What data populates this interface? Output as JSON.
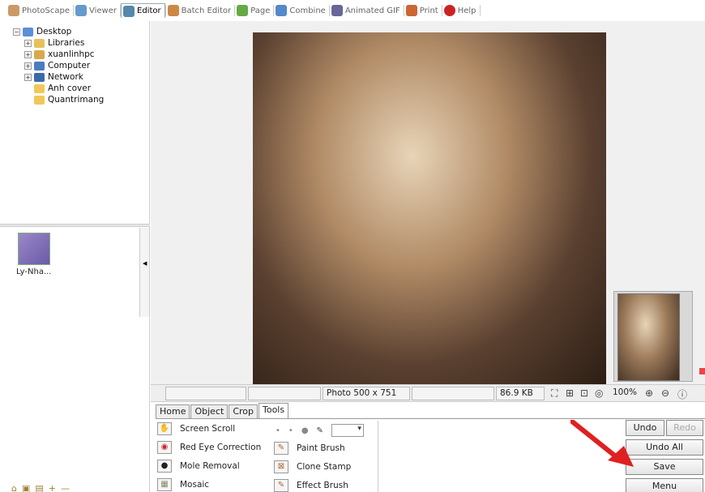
{
  "top_tabs": [
    {
      "label": "PhotoScape",
      "color": "#c96"
    },
    {
      "label": "Viewer",
      "color": "#69c"
    },
    {
      "label": "Editor",
      "color": "#58a",
      "active": true
    },
    {
      "label": "Batch Editor",
      "color": "#c84"
    },
    {
      "label": "Page",
      "color": "#6a4"
    },
    {
      "label": "Combine",
      "color": "#58c"
    },
    {
      "label": "Animated GIF",
      "color": "#669"
    },
    {
      "label": "Print",
      "color": "#c63"
    },
    {
      "label": "Help",
      "color": "#c22"
    }
  ],
  "tree": {
    "root": "Desktop",
    "items": [
      "Libraries",
      "xuanlinhpc",
      "Computer",
      "Network",
      "Anh cover",
      "Quantrimang"
    ]
  },
  "thumbnail": {
    "label": "Ly-Nha..."
  },
  "status": {
    "photo_size": "Photo 500 x 751",
    "file_size": "86.9 KB",
    "zoom": "100%"
  },
  "tool_tabs": [
    "Home",
    "Object",
    "Crop",
    "Tools"
  ],
  "tools_left": [
    "Screen Scroll",
    "Red Eye Correction",
    "Mole Removal",
    "Mosaic"
  ],
  "tools_right": [
    "Paint Brush",
    "Clone Stamp",
    "Effect Brush"
  ],
  "buttons": {
    "undo": "Undo",
    "redo": "Redo",
    "undo_all": "Undo All",
    "save": "Save",
    "menu": "Menu"
  },
  "colors": {
    "annotation_arrow": "#e02020"
  }
}
